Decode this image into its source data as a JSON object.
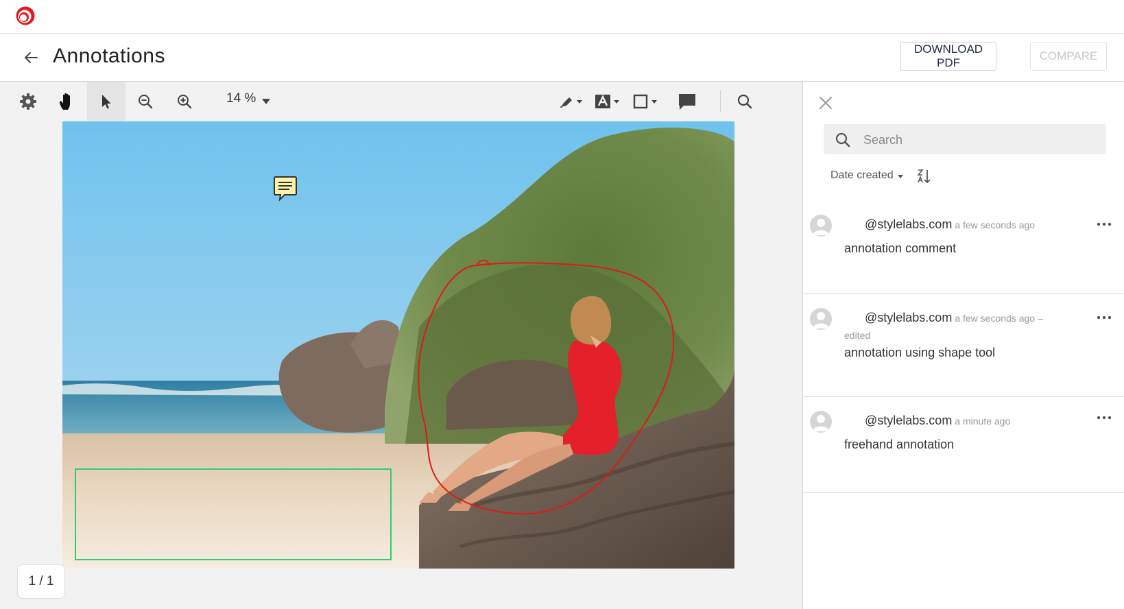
{
  "header": {
    "title": "Annotations",
    "download_label": "DOWNLOAD PDF",
    "compare_label": "COMPARE"
  },
  "toolbar": {
    "zoom": "14 %"
  },
  "pager": {
    "text": "1 / 1"
  },
  "panel": {
    "search_placeholder": "Search",
    "sort_label": "Date created",
    "comments": [
      {
        "user": "@stylelabs.com",
        "time": "a few seconds ago",
        "edited": "",
        "text": "annotation comment"
      },
      {
        "user": "@stylelabs.com",
        "time": "a few seconds ago –",
        "edited": "edited",
        "text": "annotation using shape tool"
      },
      {
        "user": "@stylelabs.com",
        "time": "a minute ago",
        "edited": "",
        "text": "freehand annotation"
      }
    ]
  },
  "colors": {
    "accent_red": "#e31b1b",
    "freehand_stroke": "#e01818",
    "rect_stroke": "#2ecc71",
    "note_fill": "#fff3a8"
  },
  "icons": [
    "app-logo-icon",
    "back-arrow-icon",
    "gear-icon",
    "hand-pan-icon",
    "pointer-icon",
    "zoom-out-icon",
    "zoom-in-icon",
    "caret-down-icon",
    "highlighter-icon",
    "text-tool-icon",
    "shape-tool-icon",
    "comment-tool-icon",
    "search-icon",
    "close-icon",
    "sort-descending-icon",
    "more-options-icon",
    "avatar-icon",
    "sticky-note-icon"
  ]
}
